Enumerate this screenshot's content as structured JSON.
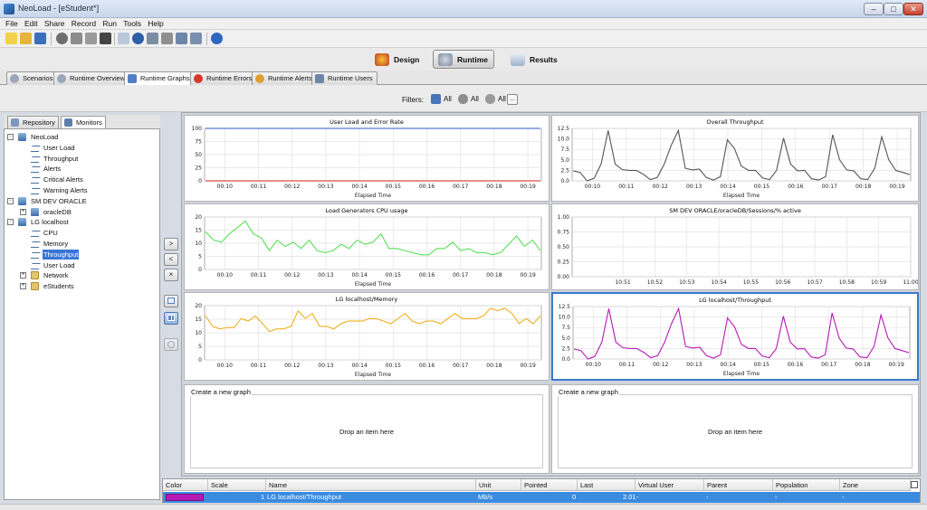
{
  "window": {
    "title": "NeoLoad - [eStudent*]"
  },
  "menu": [
    "File",
    "Edit",
    "Share",
    "Record",
    "Run",
    "Tools",
    "Help"
  ],
  "modes": [
    {
      "label": "Design",
      "icon": "design-icon"
    },
    {
      "label": "Runtime",
      "icon": "runtime-gears-icon",
      "active": true
    },
    {
      "label": "Results",
      "icon": "results-chart-icon"
    }
  ],
  "tabs": [
    {
      "label": "Scenarios"
    },
    {
      "label": "Runtime Overview"
    },
    {
      "label": "Runtime Graphs",
      "active": true
    },
    {
      "label": "Runtime Errors"
    },
    {
      "label": "Runtime Alerts"
    },
    {
      "label": "Runtime Users"
    }
  ],
  "filters": {
    "label": "Filters:",
    "population": "All",
    "virtual_user": "All",
    "zone": "All",
    "more": "..."
  },
  "left_tabs": [
    {
      "label": "Repository"
    },
    {
      "label": "Monitors",
      "active": true
    }
  ],
  "tree": [
    {
      "label": "NeoLoad",
      "level": 0,
      "icon": "group",
      "expander": "-"
    },
    {
      "label": "User Load",
      "level": 1,
      "icon": "wave"
    },
    {
      "label": "Throughput",
      "level": 1,
      "icon": "wave"
    },
    {
      "label": "Alerts",
      "level": 1,
      "icon": "wave"
    },
    {
      "label": "Critical Alerts",
      "level": 1,
      "icon": "wave"
    },
    {
      "label": "Warning Alerts",
      "level": 1,
      "icon": "wave"
    },
    {
      "label": "SM DEV ORACLE",
      "level": 0,
      "icon": "group",
      "expander": "-"
    },
    {
      "label": "oracleDB",
      "level": 1,
      "icon": "group",
      "expander": "+"
    },
    {
      "label": "LG localhost",
      "level": 0,
      "icon": "group",
      "expander": "-"
    },
    {
      "label": "CPU",
      "level": 1,
      "icon": "wave"
    },
    {
      "label": "Memory",
      "level": 1,
      "icon": "wave"
    },
    {
      "label": "Throughput",
      "level": 1,
      "icon": "wave",
      "selected": true
    },
    {
      "label": "User Load",
      "level": 1,
      "icon": "wave"
    },
    {
      "label": "Network",
      "level": 1,
      "icon": "folder",
      "expander": "+"
    },
    {
      "label": "eStudents",
      "level": 1,
      "icon": "folder",
      "expander": "+"
    }
  ],
  "middle_buttons": [
    ">",
    "<",
    "×"
  ],
  "time_ticks": [
    "00:10",
    "00:11",
    "00:12",
    "00:13",
    "00:14",
    "00:15",
    "00:16",
    "00:17",
    "00:18",
    "00:19"
  ],
  "charts": [
    {
      "title": "User Load and Error Rate",
      "xlabel": "Elapsed Time",
      "y_ticks": [
        "100",
        "75",
        "50",
        "25",
        "0"
      ],
      "ylim": [
        0,
        100
      ],
      "x_ticks": "time",
      "series": [
        {
          "color": "#2d59c8",
          "values": [
            100,
            100,
            100,
            100,
            100,
            100,
            100,
            100,
            100,
            100,
            100,
            100,
            100,
            100,
            100,
            100,
            100,
            100,
            100,
            100,
            100,
            100,
            100,
            100,
            100,
            100,
            100,
            100,
            100,
            100,
            100,
            100,
            100,
            100,
            100,
            100,
            100,
            100,
            100,
            100,
            100,
            100,
            100,
            100,
            100,
            100,
            100,
            100,
            100,
            100,
            100
          ]
        },
        {
          "color": "#d02020",
          "values": [
            0,
            0,
            0,
            0,
            0,
            0,
            0,
            0,
            0,
            0,
            0,
            0,
            0,
            0,
            0,
            0,
            0,
            0,
            0,
            0,
            0,
            0,
            0,
            0,
            0,
            0,
            0,
            0,
            0,
            0,
            0,
            0,
            0,
            0,
            0,
            0,
            0,
            0,
            0,
            0,
            0,
            0,
            0,
            0,
            0,
            0,
            0,
            0,
            0,
            0,
            0
          ]
        }
      ]
    },
    {
      "title": "Overall Throughput",
      "xlabel": "Elapsed Time",
      "y_ticks": [
        "12.5",
        "10.0",
        "7.5",
        "5.0",
        "2.5",
        "0.0"
      ],
      "ylim": [
        0,
        12.5
      ],
      "x_ticks": "time",
      "series": [
        {
          "color": "#555555",
          "values": [
            2.4,
            2,
            0,
            0.6,
            4,
            12,
            4,
            2.7,
            2.5,
            2.5,
            1.6,
            0.3,
            0.8,
            4,
            8.5,
            12,
            3,
            2.6,
            2.8,
            0.8,
            0.2,
            1,
            9.8,
            7.7,
            3.5,
            2.5,
            2.5,
            0.7,
            0.3,
            2.5,
            10.2,
            4,
            2.4,
            2.5,
            0.5,
            0.2,
            1,
            11,
            5,
            2.6,
            2.4,
            0.5,
            0.3,
            3,
            10.5,
            5,
            2.5,
            2,
            1.5
          ]
        }
      ]
    },
    {
      "title": "Load Generators CPU usage",
      "xlabel": "Elapsed Time",
      "y_ticks": [
        "20",
        "15",
        "10",
        "5",
        "0"
      ],
      "ylim": [
        0,
        25
      ],
      "x_ticks": "time",
      "series": [
        {
          "color": "#58e058",
          "values": [
            18,
            14,
            13,
            17,
            20,
            23,
            17,
            15,
            9,
            14,
            11,
            13,
            10,
            14,
            9,
            8,
            9,
            12,
            10,
            14,
            12,
            13,
            17,
            10,
            10,
            9,
            8,
            7,
            7,
            10,
            10,
            13,
            9,
            10,
            8,
            8,
            7,
            8,
            12,
            16,
            11,
            14,
            9
          ]
        }
      ]
    },
    {
      "title": "SM DEV ORACLE/oracleDB/Sessions/% active",
      "xlabel": "",
      "y_ticks": [
        "1.00",
        "0.75",
        "0.50",
        "0.25",
        "0.00"
      ],
      "ylim": [
        0,
        1
      ],
      "x_ticks": [
        "10:51",
        "10:52",
        "10:53",
        "10:54",
        "10:55",
        "10:56",
        "10:57",
        "10:58",
        "10:59",
        "11:00"
      ],
      "series": []
    },
    {
      "title": "LG localhost/Memory",
      "xlabel": "Elapsed Time",
      "y_ticks": [
        "20",
        "15",
        "10",
        "5",
        "0"
      ],
      "ylim": [
        0,
        21
      ],
      "x_ticks": "time",
      "series": [
        {
          "color": "#f0b020",
          "values": [
            17,
            13,
            12,
            12.5,
            12.5,
            16,
            15,
            17,
            14,
            11,
            12,
            12,
            13,
            19,
            16,
            18,
            13,
            13,
            12,
            14,
            15,
            15,
            15,
            16,
            16,
            15,
            14,
            16,
            18,
            15,
            14,
            15,
            15,
            14,
            16,
            18,
            16,
            16,
            16,
            17,
            20,
            19,
            20,
            18,
            14,
            16,
            14,
            17
          ]
        }
      ]
    },
    {
      "title": "LG localhost/Throughput",
      "xlabel": "Elapsed Time",
      "y_ticks": [
        "12.5",
        "10.0",
        "7.5",
        "5.0",
        "2.5",
        "0.0"
      ],
      "ylim": [
        0,
        12.5
      ],
      "x_ticks": "time",
      "selected": true,
      "series": [
        {
          "color": "#b51ab5",
          "values": [
            2.4,
            2,
            0,
            0.6,
            4,
            12,
            4,
            2.7,
            2.5,
            2.5,
            1.6,
            0.3,
            0.8,
            4,
            8.5,
            12,
            3,
            2.6,
            2.8,
            0.8,
            0.2,
            1,
            9.8,
            7.7,
            3.5,
            2.5,
            2.5,
            0.7,
            0.3,
            2.5,
            10.2,
            4,
            2.4,
            2.5,
            0.5,
            0.2,
            1,
            11,
            5,
            2.6,
            2.4,
            0.5,
            0.3,
            3,
            10.5,
            5,
            2.5,
            2,
            1.5
          ]
        }
      ]
    }
  ],
  "dropzones": [
    {
      "label": "Create a new graph",
      "text": "Drop an item here"
    },
    {
      "label": "Create a new graph",
      "text": "Drop an item here"
    }
  ],
  "table": {
    "headers": [
      "Color",
      "Scale",
      "Name",
      "Unit",
      "Pointed",
      "Last",
      "Virtual User",
      "Parent",
      "Population",
      "Zone"
    ],
    "row": {
      "color": "#b51ab5",
      "scale": "1",
      "name": "LG localhost/Throughput",
      "unit": "Mb/s",
      "pointed": "0",
      "last": "2.01",
      "virtual_user": "-",
      "parent": "-",
      "population": "-",
      "zone": "-"
    }
  }
}
